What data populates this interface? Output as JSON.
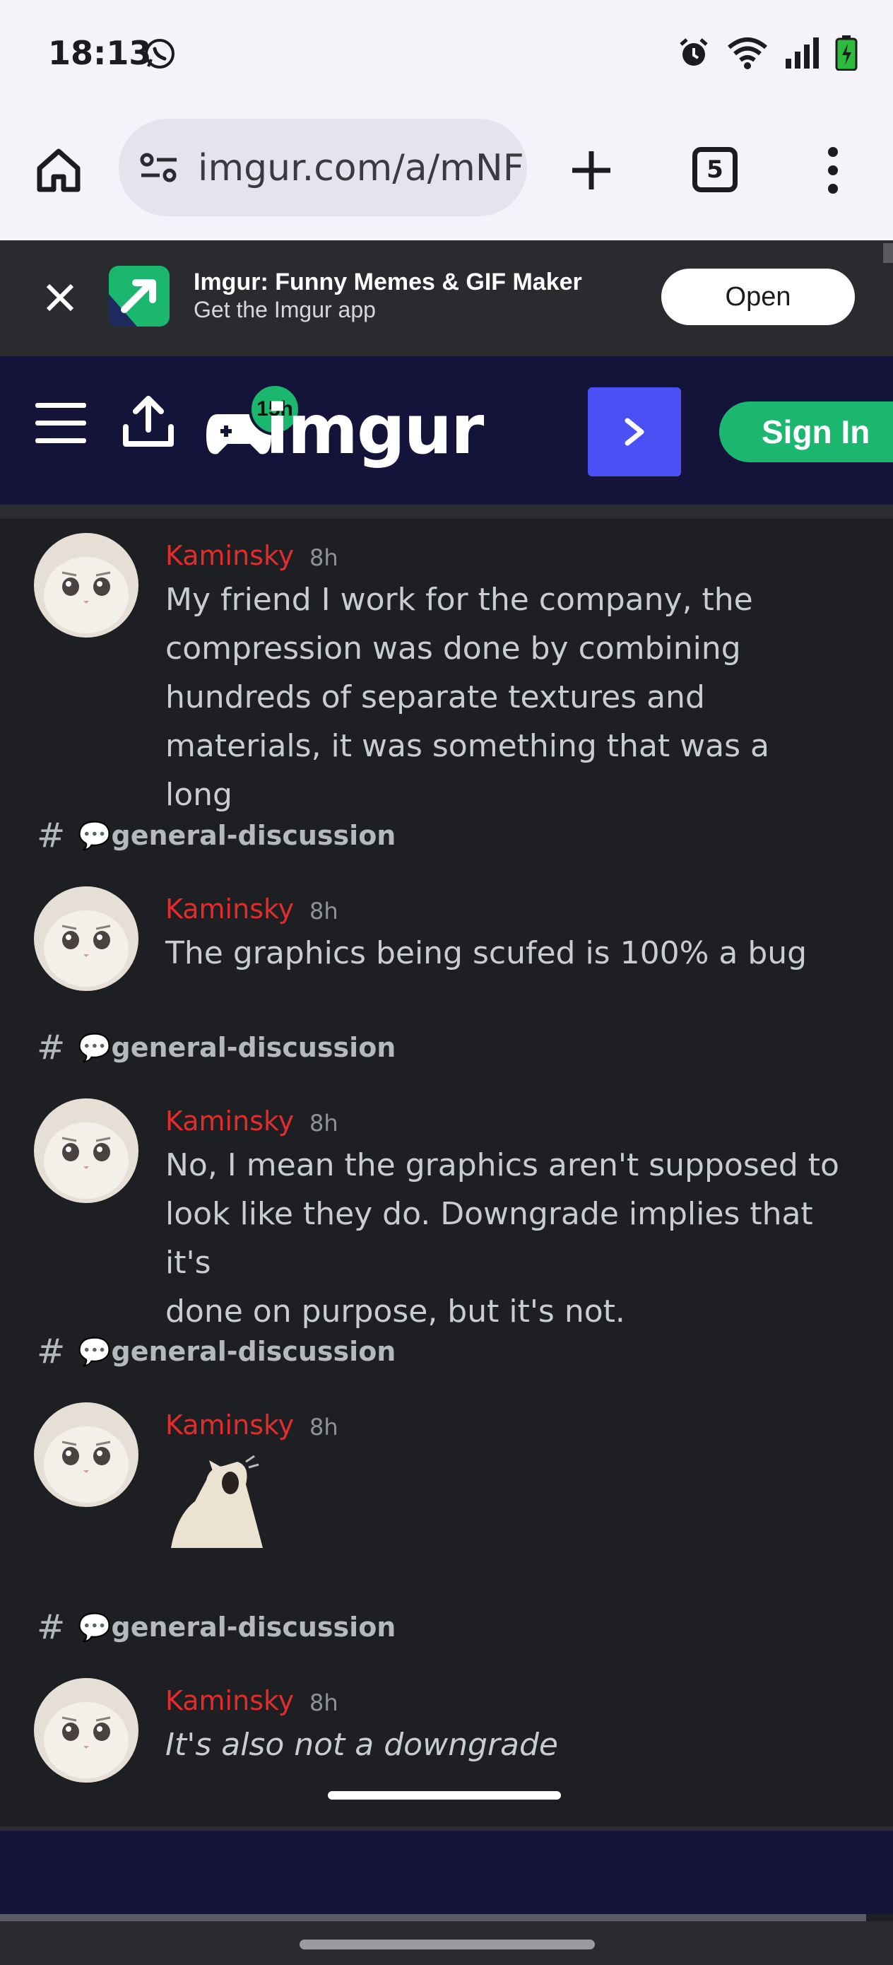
{
  "status_bar": {
    "time": "18:13"
  },
  "browser": {
    "url": "imgur.com/a/mNF",
    "tab_count": "5"
  },
  "app_banner": {
    "title": "Imgur: Funny Memes & GIF Maker",
    "subtitle": "Get the Imgur app",
    "open_label": "Open"
  },
  "imgur_header": {
    "logo_text": "imgur",
    "badge": "15h",
    "signin_label": "Sign In"
  },
  "messages": [
    {
      "author": "Kaminsky",
      "time": "8h",
      "lines": [
        "My friend I work for the company, the",
        "compression was done by combining",
        "hundreds of separate textures and",
        "materials, it was something that was a long"
      ]
    },
    {
      "channel": "💬general-discussion",
      "author": "Kaminsky",
      "time": "8h",
      "lines": [
        "The graphics being scufed is 100% a bug"
      ]
    },
    {
      "channel": "💬general-discussion",
      "author": "Kaminsky",
      "time": "8h",
      "lines": [
        "No, I mean the graphics aren't supposed to",
        "look like they do. Downgrade implies that it's",
        "done on purpose, but it's not."
      ]
    },
    {
      "channel": "💬general-discussion",
      "author": "Kaminsky",
      "time": "8h",
      "sticker": "screaming-cat-sticker"
    },
    {
      "channel": "💬general-discussion",
      "author": "Kaminsky",
      "time": "8h",
      "lines": [
        "It's also not a downgrade"
      ],
      "italic": true
    }
  ],
  "colors": {
    "author": "#e12d2d",
    "imgur_nav": "#14133a",
    "next_button": "#4b50f5",
    "signin": "#1bb76e"
  }
}
